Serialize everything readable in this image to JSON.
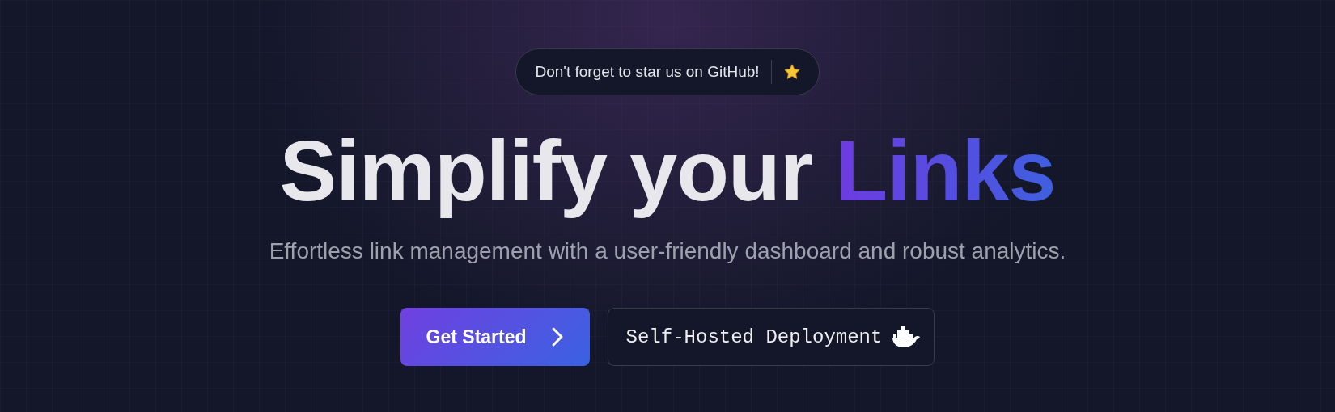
{
  "announcement": {
    "text": "Don't forget to star us on GitHub!"
  },
  "headline": {
    "text": "Simplify your",
    "highlight": "Links"
  },
  "subtitle": "Effortless link management with a user-friendly dashboard and robust analytics.",
  "buttons": [
    {
      "kind": "primary",
      "label": "Get Started"
    },
    {
      "kind": "secondary",
      "label": "Self-Hosted Deployment"
    }
  ]
}
